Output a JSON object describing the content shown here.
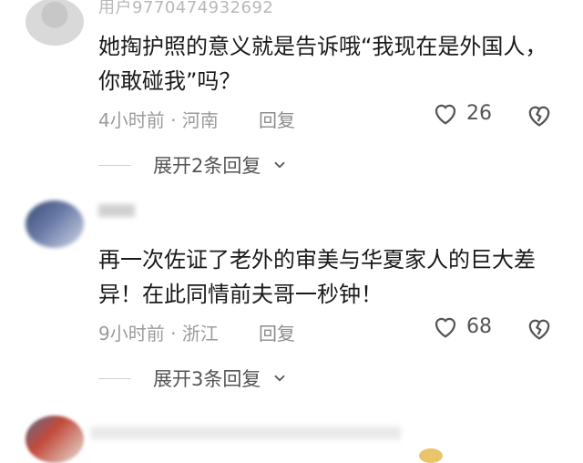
{
  "comments": [
    {
      "username": "用户977047493​2692",
      "text": "她掏护照的意义就是告诉哦“我现在是外国人，你敢碰我”吗？",
      "time_location": "4小时前 · 河南",
      "reply_label": "回复",
      "likes": "26",
      "expand_label": "展开2条回复"
    },
    {
      "username": "",
      "text": "再一次佐证了老外的审美与华夏家人的巨大差异！在此同情前夫哥一秒钟！",
      "time_location": "9小时前 · 浙江",
      "reply_label": "回复",
      "likes": "68",
      "expand_label": "展开3条回复"
    }
  ],
  "icons": {
    "like": "heart-icon",
    "dislike": "broken-heart-icon",
    "expand": "chevron-down-icon"
  }
}
